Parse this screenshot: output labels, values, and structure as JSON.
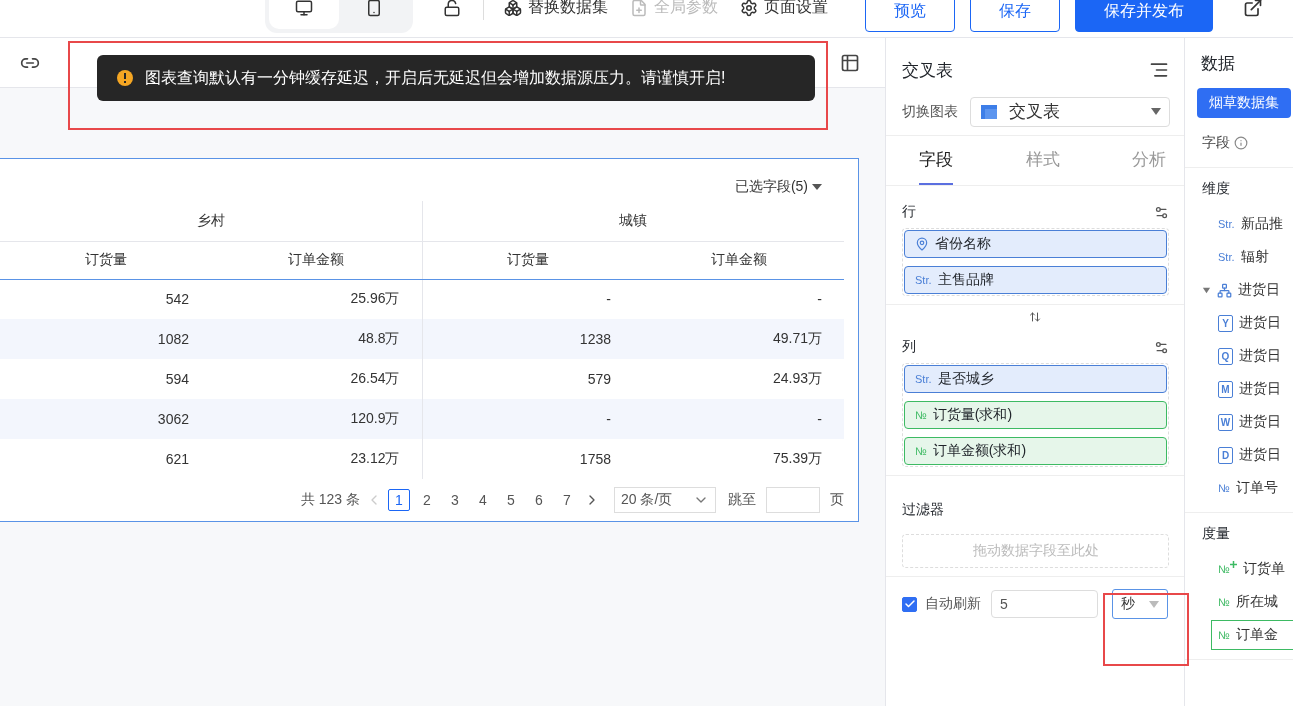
{
  "top_bar": {
    "devices": [
      {
        "kind": "desktop",
        "selected": true
      },
      {
        "kind": "mobile",
        "selected": false
      }
    ],
    "actions": [
      {
        "kind": "swap",
        "label": "替换数据集",
        "disabled": false
      },
      {
        "kind": "params",
        "label": "全局参数",
        "disabled": true
      },
      {
        "kind": "settings",
        "label": "页面设置",
        "disabled": false
      }
    ],
    "buttons": [
      {
        "label": "预览",
        "primary": false
      },
      {
        "label": "保存",
        "primary": false
      },
      {
        "label": "保存并发布",
        "primary": true
      }
    ]
  },
  "toast": {
    "message": "图表查询默认有一分钟缓存延迟，开启后无延迟但会增加数据源压力。请谨慎开启!"
  },
  "table": {
    "field_picker": "已选字段(5)",
    "groups": [
      {
        "label": "乡村",
        "columns": [
          "订货量",
          "订单金额"
        ]
      },
      {
        "label": "城镇",
        "columns": [
          "订货量",
          "订单金额"
        ]
      }
    ],
    "rows": [
      [
        "542",
        "25.96万",
        "-",
        "-"
      ],
      [
        "1082",
        "48.8万",
        "1238",
        "49.71万"
      ],
      [
        "594",
        "26.54万",
        "579",
        "24.93万"
      ],
      [
        "3062",
        "120.9万",
        "-",
        "-"
      ],
      [
        "621",
        "23.12万",
        "1758",
        "75.39万"
      ]
    ],
    "pagination": {
      "total": "共 123 条",
      "pages": [
        {
          "label": "1",
          "selected": true
        },
        {
          "label": "2",
          "selected": false
        },
        {
          "label": "3",
          "selected": false
        },
        {
          "label": "4",
          "selected": false
        },
        {
          "label": "5",
          "selected": false
        },
        {
          "label": "6",
          "selected": false
        },
        {
          "label": "7",
          "selected": false
        }
      ],
      "page_size": "20 条/页",
      "jump_label": "跳至",
      "page_suffix": "页"
    }
  },
  "chart_panel": {
    "title": "交叉表",
    "switch_label": "切换图表",
    "chart_type": "交叉表",
    "tabs": [
      {
        "label": "字段",
        "selected": true
      },
      {
        "label": "样式",
        "selected": false
      },
      {
        "label": "分析",
        "selected": false
      }
    ],
    "sections": [
      {
        "title": "行",
        "fields": [
          {
            "kind": "geo",
            "label": "省份名称"
          },
          {
            "kind": "str",
            "badge": "Str.",
            "label": "主售品牌"
          }
        ]
      },
      {
        "title": "列",
        "fields": [
          {
            "kind": "str",
            "badge": "Str.",
            "label": "是否城乡"
          },
          {
            "kind": "num",
            "badge": "№",
            "label": "订货量(求和)"
          },
          {
            "kind": "num",
            "badge": "№",
            "label": "订单金额(求和)"
          }
        ]
      }
    ],
    "filter": {
      "title": "过滤器",
      "placeholder": "拖动数据字段至此处"
    },
    "auto_refresh": {
      "checked": true,
      "label": "自动刷新",
      "value": "5",
      "unit": "秒"
    }
  },
  "data_panel": {
    "title": "数据",
    "dataset": "烟草数据集",
    "fields_label": "字段",
    "dimensions": {
      "title": "维度",
      "items": [
        {
          "kind": "str",
          "badge": "Str.",
          "label": "新品推",
          "selected": false
        },
        {
          "kind": "str",
          "badge": "Str.",
          "label": "辐射",
          "selected": false
        },
        {
          "kind": "hierarchy",
          "label": "进货日",
          "expanded": true,
          "selected": false,
          "children": [
            {
              "kind": "date",
              "badge": "Y",
              "label": "进货日",
              "selected": false
            },
            {
              "kind": "date",
              "badge": "Q",
              "label": "进货日",
              "selected": false
            },
            {
              "kind": "date",
              "badge": "M",
              "label": "进货日",
              "selected": false
            },
            {
              "kind": "date",
              "badge": "W",
              "label": "进货日",
              "selected": false
            },
            {
              "kind": "date",
              "badge": "D",
              "label": "进货日",
              "selected": false
            }
          ]
        },
        {
          "kind": "num",
          "badge": "№",
          "label": "订单号",
          "selected": false
        }
      ]
    },
    "measures": {
      "title": "度量",
      "items": [
        {
          "kind": "calc",
          "badge": "№",
          "label": "订货单",
          "selected": false
        },
        {
          "kind": "num",
          "badge": "№",
          "label": "所在城",
          "selected": false
        },
        {
          "kind": "num",
          "badge": "№",
          "label": "订单金",
          "selected": true
        }
      ]
    }
  }
}
